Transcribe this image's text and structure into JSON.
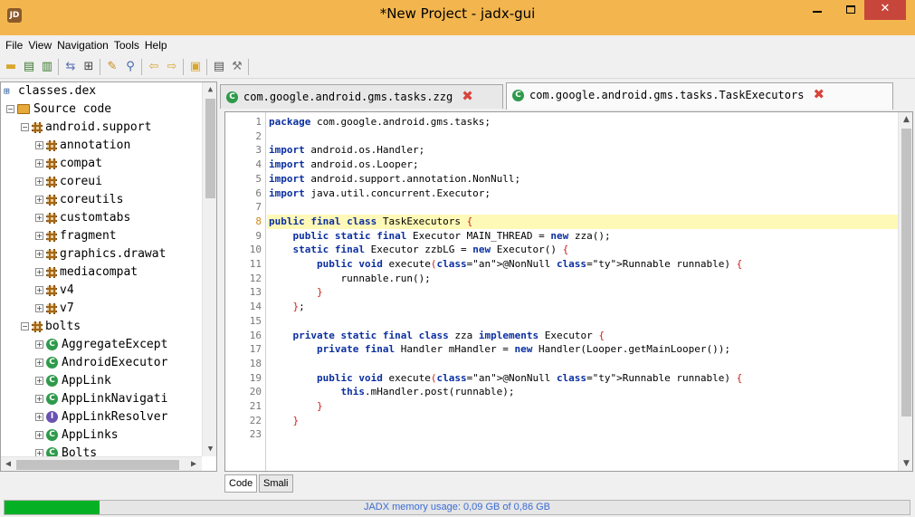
{
  "window": {
    "title": "*New Project - jadx-gui",
    "minimize_label": "",
    "close_label": "✕"
  },
  "menu": [
    "File",
    "View",
    "Navigation",
    "Tools",
    "Help"
  ],
  "tree": {
    "root": "classes.dex",
    "source_code": "Source code",
    "nodes": [
      {
        "label": "android.support",
        "kind": "package",
        "expanded": true,
        "level": 2
      },
      {
        "label": "annotation",
        "kind": "package",
        "level": 3
      },
      {
        "label": "compat",
        "kind": "package",
        "level": 3
      },
      {
        "label": "coreui",
        "kind": "package",
        "level": 3
      },
      {
        "label": "coreutils",
        "kind": "package",
        "level": 3
      },
      {
        "label": "customtabs",
        "kind": "package",
        "level": 3
      },
      {
        "label": "fragment",
        "kind": "package",
        "level": 3
      },
      {
        "label": "graphics.drawat",
        "kind": "package",
        "level": 3
      },
      {
        "label": "mediacompat",
        "kind": "package",
        "level": 3
      },
      {
        "label": "v4",
        "kind": "package",
        "level": 3
      },
      {
        "label": "v7",
        "kind": "package",
        "level": 3
      },
      {
        "label": "bolts",
        "kind": "package",
        "expanded": true,
        "level": 2
      },
      {
        "label": "AggregateExcept",
        "kind": "class",
        "level": 3
      },
      {
        "label": "AndroidExecutor",
        "kind": "class-anon",
        "level": 3
      },
      {
        "label": "AppLink",
        "kind": "class",
        "level": 3
      },
      {
        "label": "AppLinkNavigati",
        "kind": "class",
        "level": 3
      },
      {
        "label": "AppLinkResolver",
        "kind": "interface",
        "level": 3
      },
      {
        "label": "AppLinks",
        "kind": "class",
        "level": 3
      },
      {
        "label": "Bolts",
        "kind": "class",
        "level": 3
      },
      {
        "label": "BoltsExecutors",
        "kind": "class-anon",
        "level": 3
      }
    ]
  },
  "tabs": [
    {
      "label": "com.google.android.gms.tasks.zzg",
      "active": false
    },
    {
      "label": "com.google.android.gms.tasks.TaskExecutors",
      "active": true
    }
  ],
  "editor": {
    "highlight_line": 8,
    "lines": [
      "package com.google.android.gms.tasks;",
      "",
      "import android.os.Handler;",
      "import android.os.Looper;",
      "import android.support.annotation.NonNull;",
      "import java.util.concurrent.Executor;",
      "",
      "public final class TaskExecutors {",
      "    public static final Executor MAIN_THREAD = new zza();",
      "    static final Executor zzbLG = new Executor() {",
      "        public void execute(@NonNull Runnable runnable) {",
      "            runnable.run();",
      "        }",
      "    };",
      "",
      "    private static final class zza implements Executor {",
      "        private final Handler mHandler = new Handler(Looper.getMainLooper());",
      "",
      "        public void execute(@NonNull Runnable runnable) {",
      "            this.mHandler.post(runnable);",
      "        }",
      "    }",
      ""
    ]
  },
  "bottom_tabs": [
    {
      "label": "Code",
      "active": true
    },
    {
      "label": "Smali",
      "active": false
    }
  ],
  "status": {
    "memory_text": "JADX memory usage: 0,09 GB of 0,86 GB",
    "memory_fraction": 0.105
  },
  "colors": {
    "titlebar": "#f3b64f",
    "progress": "#06b025",
    "highlight": "#fff9b8",
    "keyword": "#0b2fa0",
    "close_button": "#c7463b"
  }
}
